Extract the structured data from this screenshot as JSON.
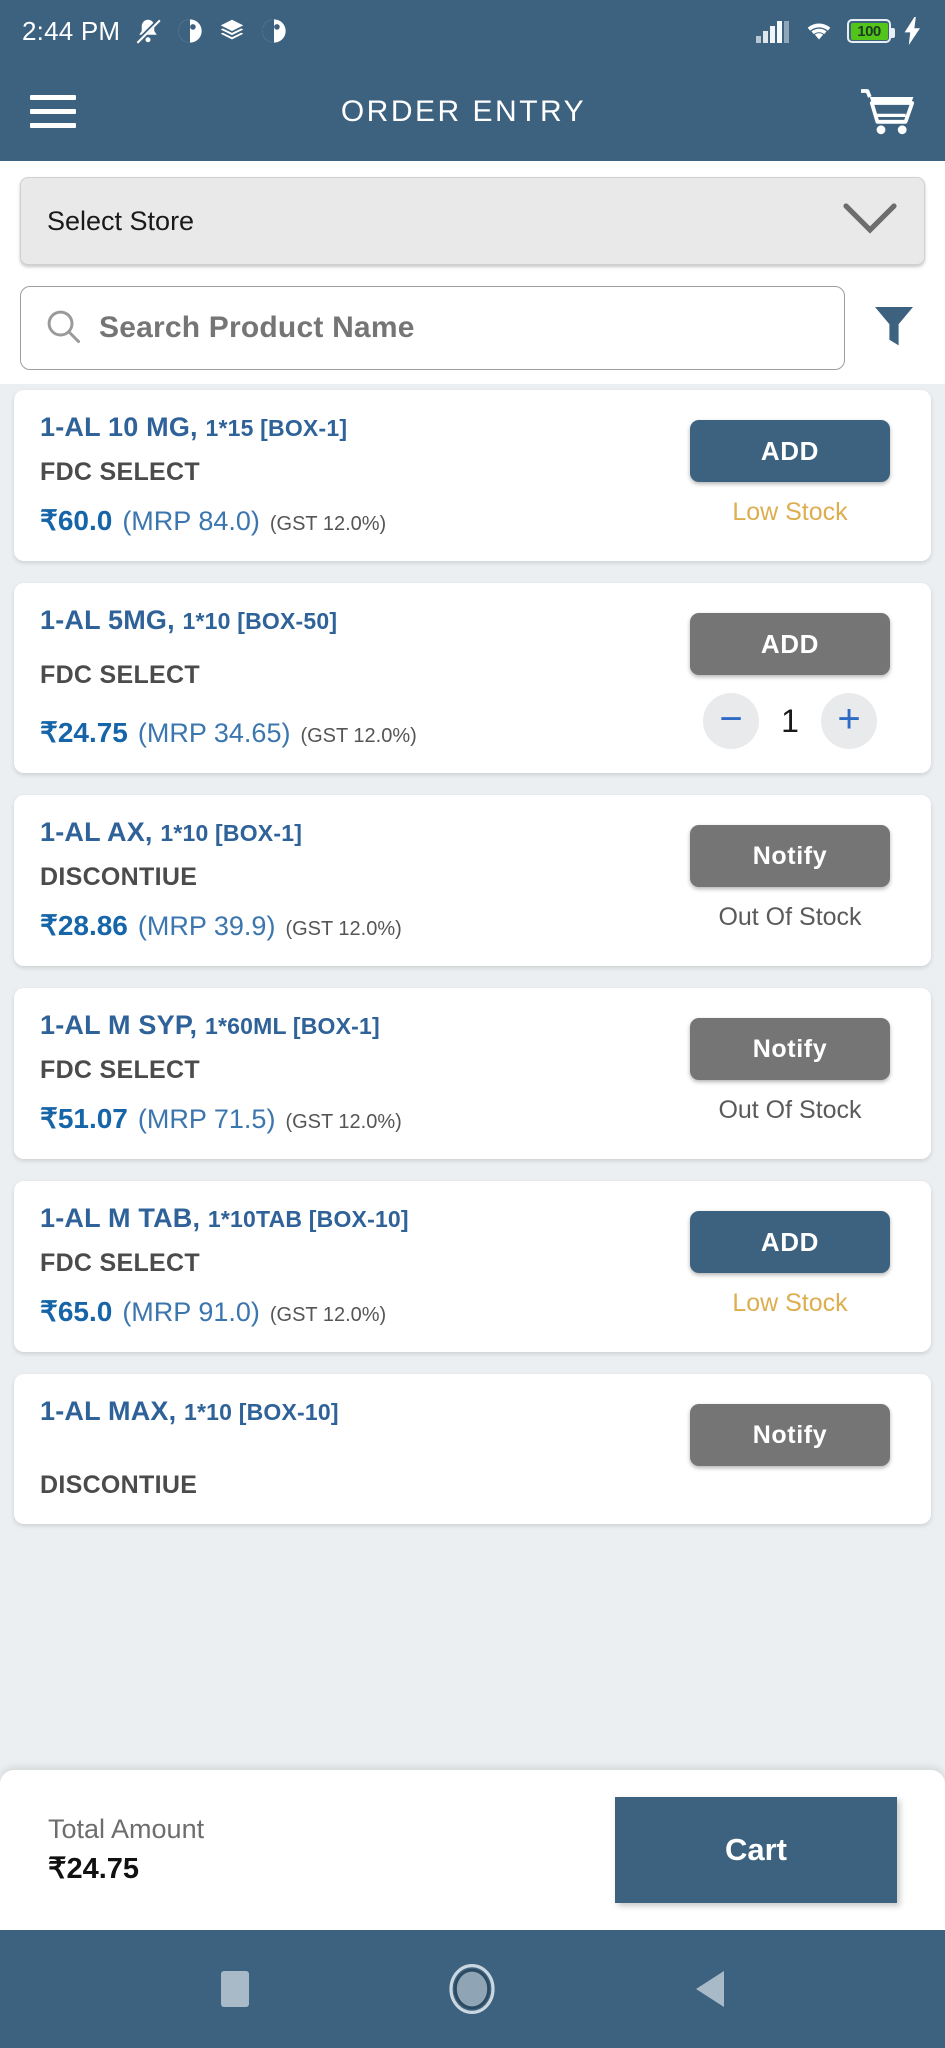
{
  "status_bar": {
    "time": "2:44 PM",
    "battery_percent": "100",
    "icons": [
      "bell-muted-icon",
      "app-badge-icon",
      "layers-icon",
      "app-badge-icon",
      "signal-icon",
      "wifi-icon",
      "battery-icon",
      "charging-bolt-icon"
    ]
  },
  "app_bar": {
    "title": "ORDER ENTRY",
    "menu_icon": "hamburger-menu-icon",
    "cart_icon": "shopping-cart-icon"
  },
  "filters": {
    "store_label": "Select Store",
    "store_chevron": "chevron-down-icon",
    "search_placeholder": "Search Product Name",
    "search_value": "",
    "search_icon": "search-icon",
    "filter_icon": "filter-funnel-icon"
  },
  "colors": {
    "brand": "#3d627f",
    "product_name": "#2f6298",
    "price": "#1565a8",
    "low_stock": "#ddae50",
    "out_of_stock": "#5a5a5a",
    "disabled_button": "#757575",
    "battery_green": "#52c41a"
  },
  "products": [
    {
      "name": "1-AL 10 MG,",
      "pack": "1*15 [BOX-1]",
      "company": "FDC SELECT",
      "rate": "₹60.0",
      "mrp": "(MRP 84.0)",
      "gst": "(GST 12.0%)",
      "action_label": "ADD",
      "action_style": "primary",
      "stock_label": "Low Stock",
      "stock_style": "low",
      "has_stepper": false,
      "quantity": ""
    },
    {
      "name": "1-AL 5MG,",
      "pack": "1*10 [BOX-50]",
      "company": "FDC SELECT",
      "rate": "₹24.75",
      "mrp": "(MRP 34.65)",
      "gst": "(GST 12.0%)",
      "action_label": "ADD",
      "action_style": "muted",
      "stock_label": "",
      "stock_style": "",
      "has_stepper": true,
      "quantity": "1"
    },
    {
      "name": "1-AL AX,",
      "pack": "1*10 [BOX-1]",
      "company": "DISCONTIUE",
      "rate": "₹28.86",
      "mrp": "(MRP 39.9)",
      "gst": "(GST 12.0%)",
      "action_label": "Notify",
      "action_style": "muted",
      "stock_label": "Out Of Stock",
      "stock_style": "out",
      "has_stepper": false,
      "quantity": ""
    },
    {
      "name": "1-AL M SYP,",
      "pack": "1*60ML [BOX-1]",
      "company": "FDC SELECT",
      "rate": "₹51.07",
      "mrp": "(MRP 71.5)",
      "gst": "(GST 12.0%)",
      "action_label": "Notify",
      "action_style": "muted",
      "stock_label": "Out Of Stock",
      "stock_style": "out",
      "has_stepper": false,
      "quantity": ""
    },
    {
      "name": "1-AL M TAB,",
      "pack": "1*10TAB [BOX-10]",
      "company": "FDC SELECT",
      "rate": "₹65.0",
      "mrp": "(MRP 91.0)",
      "gst": "(GST 12.0%)",
      "action_label": "ADD",
      "action_style": "primary",
      "stock_label": "Low Stock",
      "stock_style": "low",
      "has_stepper": false,
      "quantity": ""
    },
    {
      "name": "1-AL MAX,",
      "pack": "1*10 [BOX-10]",
      "company": "DISCONTIUE",
      "rate": "",
      "mrp": "",
      "gst": "",
      "action_label": "Notify",
      "action_style": "muted",
      "stock_label": "",
      "stock_style": "",
      "has_stepper": false,
      "quantity": ""
    }
  ],
  "total_bar": {
    "label": "Total Amount",
    "amount": "₹24.75",
    "cart_button": "Cart"
  },
  "nav_bar": {
    "recents_icon": "square-recents-icon",
    "home_icon": "circle-home-icon",
    "back_icon": "triangle-back-icon"
  }
}
